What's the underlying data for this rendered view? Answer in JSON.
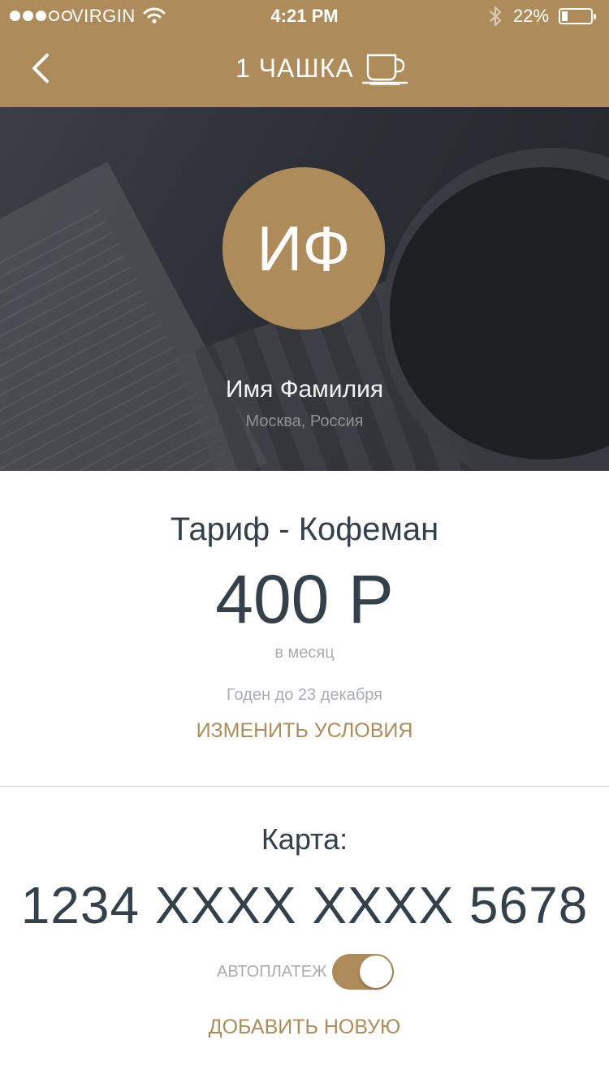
{
  "status_bar": {
    "carrier": "VIRGIN",
    "time": "4:21 PM",
    "battery_percent": "22%",
    "battery_level": 0.22,
    "signal_bars_filled": 3,
    "signal_bars_total": 5
  },
  "nav": {
    "title": "1 ЧАШКА",
    "back_icon": "chevron-left-icon",
    "title_icon": "coffee-cup-icon"
  },
  "profile": {
    "initials": "ИФ",
    "name": "Имя Фамилия",
    "location": "Москва, Россия"
  },
  "tariff": {
    "title": "Тариф - Кофеман",
    "price": "400 Р",
    "period": "в месяц",
    "valid_until": "Годен до 23 декабря",
    "change_label": "ИЗМЕНИТЬ УСЛОВИЯ"
  },
  "card": {
    "label": "Карта:",
    "number": "1234 XXXX XXXX 5678",
    "autopay_label": "АВТОПЛАТЕЖ",
    "autopay_enabled": true,
    "add_label": "ДОБАВИТЬ НОВУЮ"
  },
  "colors": {
    "accent": "#ae8b5b",
    "text_dark": "#34404a",
    "text_muted": "#a9acb0"
  }
}
